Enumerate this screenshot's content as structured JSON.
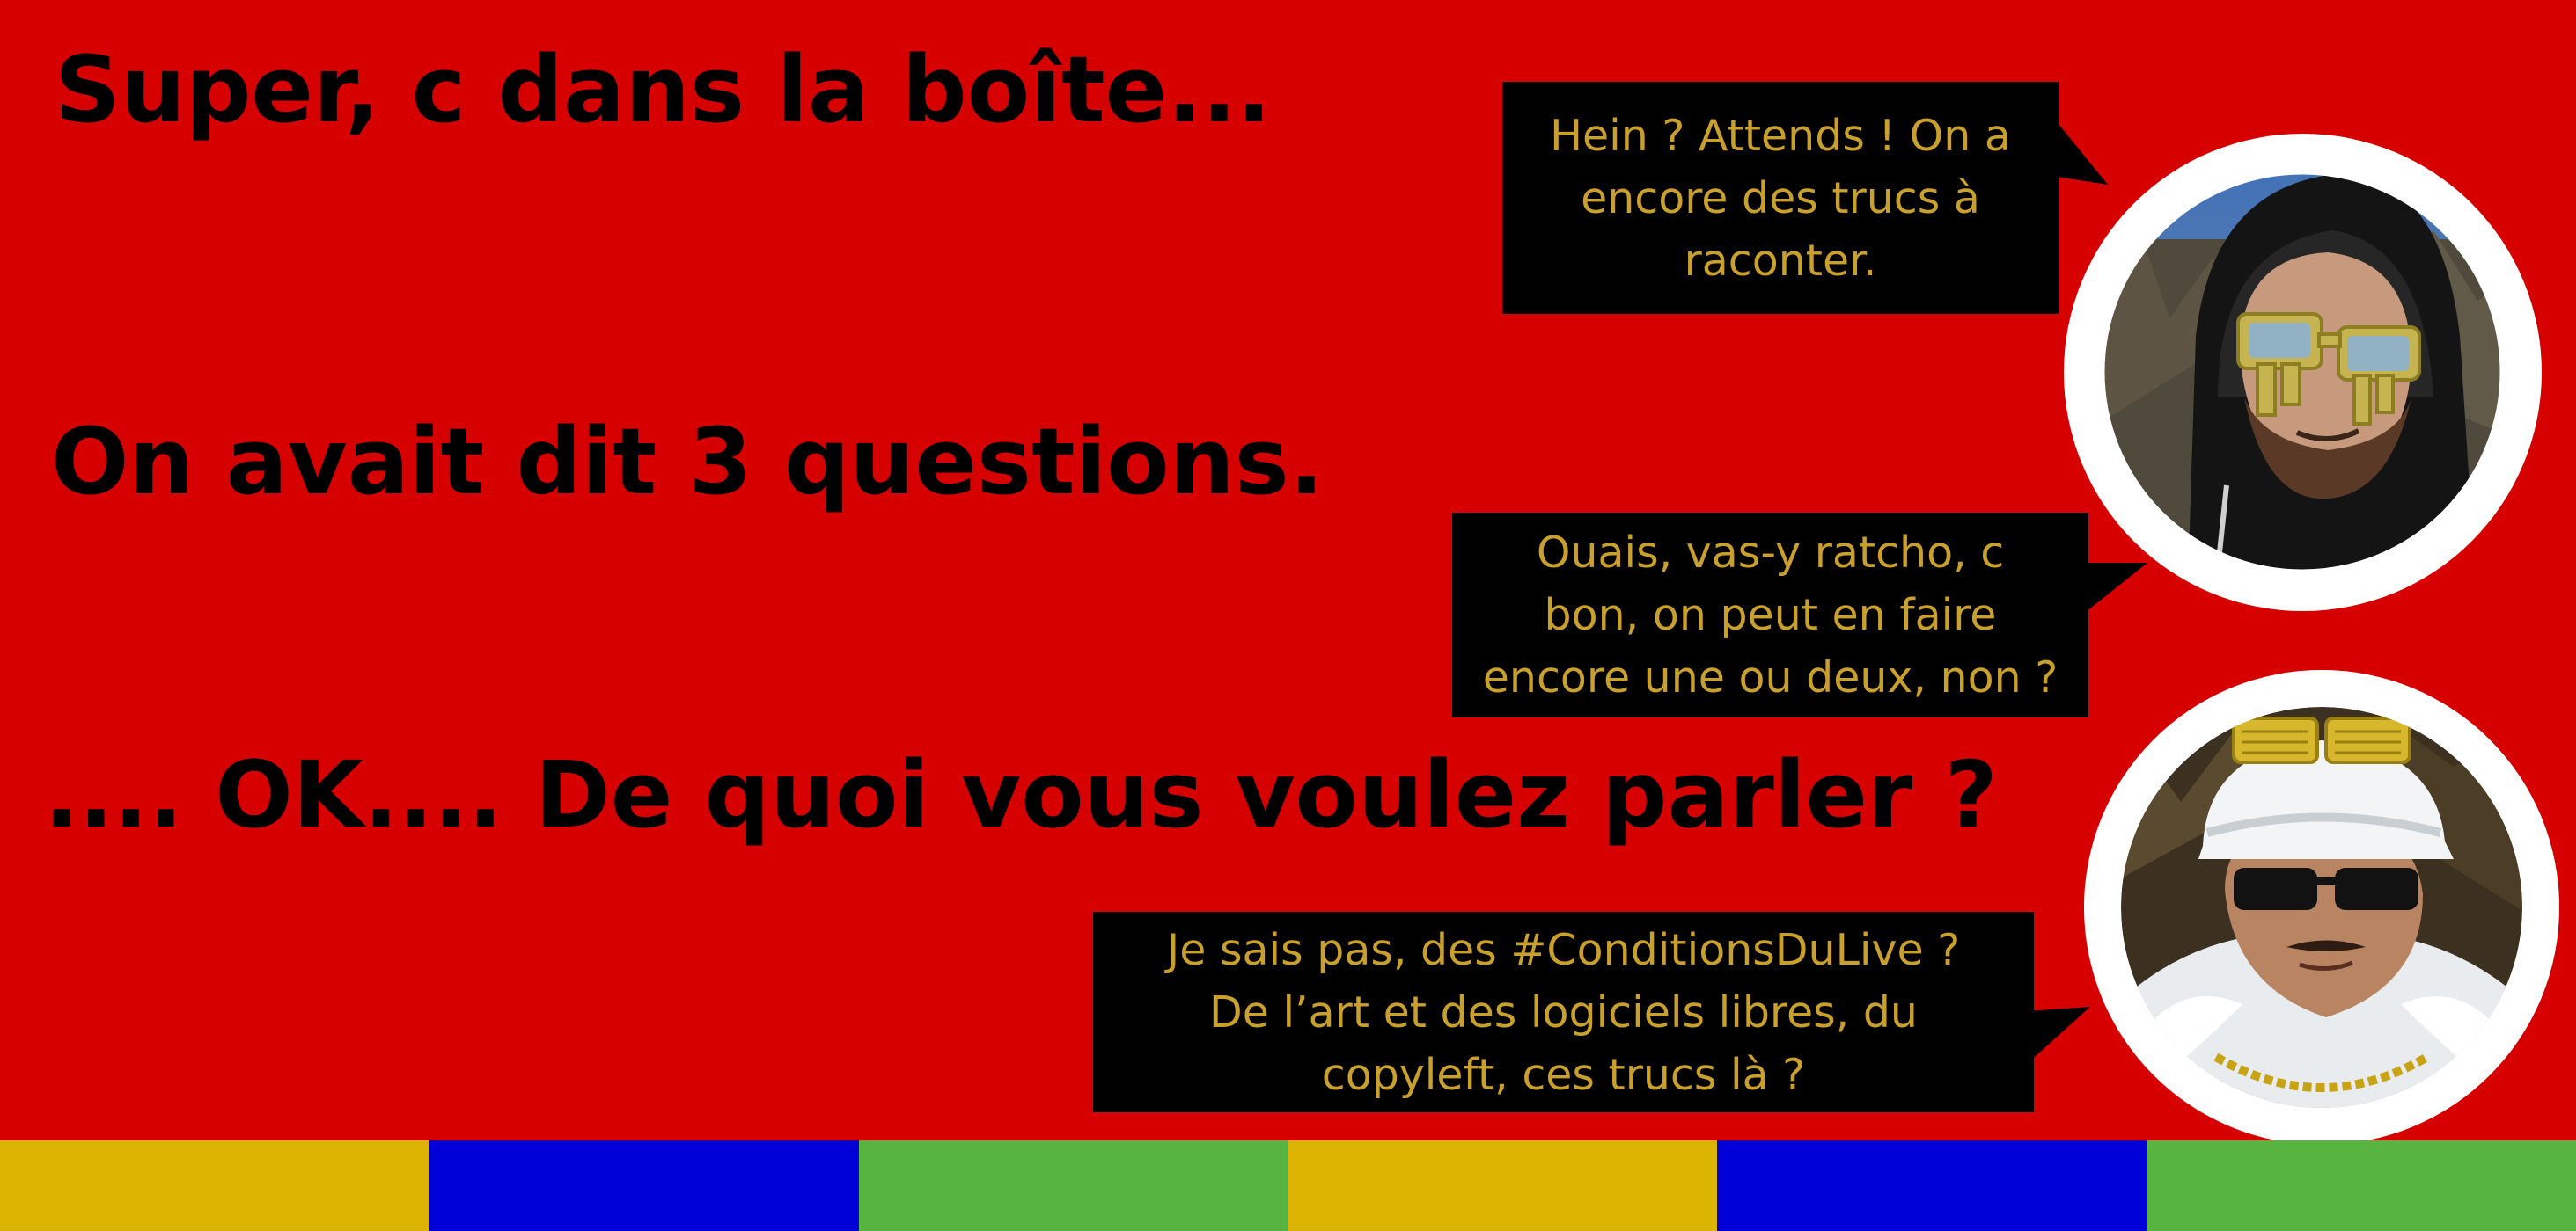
{
  "headlines": {
    "line1": "Super, c dans la boîte...",
    "line2": "On avait dit 3 questions.",
    "line3": ".... OK.... De quoi vous voulez parler ?"
  },
  "bubbles": {
    "bubble1": [
      "Hein ? Attends ! On a",
      "encore des trucs à",
      "raconter."
    ],
    "bubble2": [
      "Ouais, vas-y ratcho, c",
      "bon, on peut en faire",
      "encore une ou deux, non ?"
    ],
    "bubble3": [
      "Je sais pas, des #ConditionsDuLive ?",
      "De l’art et des logiciels libres, du",
      "copyleft, ces trucs là ?"
    ]
  },
  "colors": {
    "background": "#d60000",
    "bubble_bg": "#000000",
    "bubble_text": "#c9a02c",
    "stripes": [
      "#dab400",
      "#0000d8",
      "#58b440",
      "#dab400",
      "#0000d8",
      "#58b440"
    ]
  }
}
